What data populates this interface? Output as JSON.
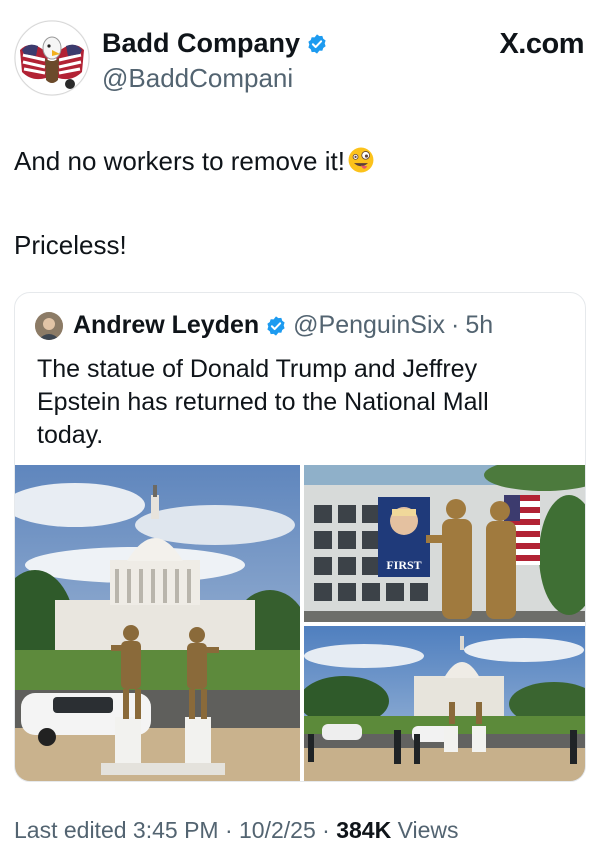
{
  "post": {
    "display_name": "Badd Company",
    "handle": "@BaddCompani",
    "brand": "X.com",
    "text_line1": "And no workers to remove it!",
    "text_line2": "Priceless!"
  },
  "quote": {
    "display_name": "Andrew Leyden",
    "handle": "@PenguinSix",
    "separator": "·",
    "time": "5h",
    "text": "The statue of Donald Trump and Jeffrey Epstein has returned to the National Mall today."
  },
  "media": {
    "banner_text": "FIRST"
  },
  "footer": {
    "edited": "Last edited 3:45 PM · 10/2/25",
    "separator": "·",
    "views_count": "384K",
    "views_label": "Views"
  },
  "colors": {
    "verified_blue": "#1d9bf0",
    "muted_text": "#536471",
    "text": "#0f1419",
    "border": "#e6e9ec"
  },
  "icons": [
    "eagle-flag-avatar",
    "verified-badge-icon",
    "zany-face-emoji",
    "andrew-avatar"
  ]
}
